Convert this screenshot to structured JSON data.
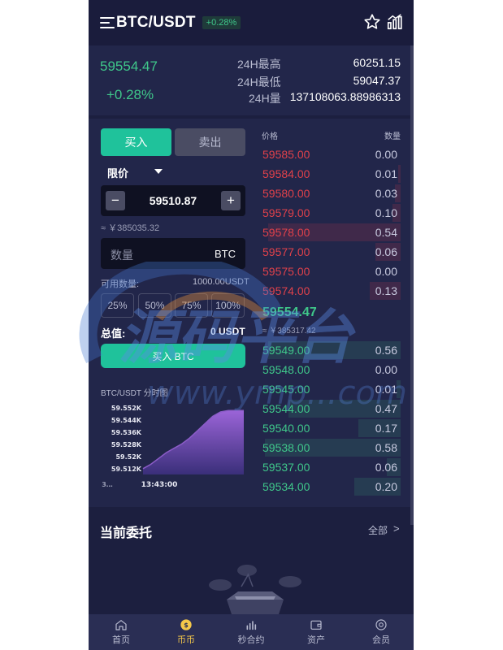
{
  "header": {
    "title": "BTC/USDT",
    "change_badge": "+0.28%"
  },
  "stats": {
    "last_price": "59554.47",
    "change": "+0.28%",
    "high_label": "24H最高",
    "high_value": "60251.15",
    "low_label": "24H最低",
    "low_value": "59047.37",
    "vol_label": "24H量",
    "vol_value": "137108063.88986313"
  },
  "trade": {
    "buy_tab": "买入",
    "sell_tab": "卖出",
    "order_type": "限价",
    "minus": "−",
    "plus": "+",
    "price_value": "59510.87",
    "price_cny": "≈ ￥385035.32",
    "qty_placeholder": "数量",
    "qty_unit": "BTC",
    "avail_label": "可用数量:",
    "avail_value": "1000.00USDT",
    "pct_buttons": [
      "25%",
      "50%",
      "75%",
      "100%"
    ],
    "total_label": "总值:",
    "total_value": "0 USDT",
    "buy_button": "买入 BTC",
    "mini_chart_title": "BTC/USDT 分时图"
  },
  "chart_data": {
    "type": "area",
    "title": "BTC/USDT 分时图",
    "y_ticks": [
      "59.552K",
      "59.544K",
      "59.536K",
      "59.528K",
      "59.52K",
      "59.512K"
    ],
    "x_ticks": [
      "3…",
      "13:43:00"
    ],
    "series": [
      {
        "y": [
          59.512,
          59.515,
          59.519,
          59.523,
          59.526,
          59.529,
          59.533,
          59.538,
          59.543,
          59.548,
          59.551,
          59.552,
          59.552,
          59.552
        ]
      }
    ],
    "ylim": [
      59.508,
      59.556
    ],
    "color": "#8b5cc7"
  },
  "orderbook": {
    "price_header": "价格",
    "qty_header": "数量",
    "asks": [
      {
        "price": "59585.00",
        "qty": "0.00",
        "depth": 0.0
      },
      {
        "price": "59584.00",
        "qty": "0.01",
        "depth": 0.02
      },
      {
        "price": "59580.00",
        "qty": "0.03",
        "depth": 0.04
      },
      {
        "price": "59579.00",
        "qty": "0.10",
        "depth": 0.06
      },
      {
        "price": "59578.00",
        "qty": "0.54",
        "depth": 0.95
      },
      {
        "price": "59577.00",
        "qty": "0.06",
        "depth": 0.18
      },
      {
        "price": "59575.00",
        "qty": "0.00",
        "depth": 0.0
      },
      {
        "price": "59574.00",
        "qty": "0.13",
        "depth": 0.22
      }
    ],
    "mid_price": "59554.47",
    "mid_cny": "≈ ￥385317.42",
    "bids": [
      {
        "price": "59549.00",
        "qty": "0.56",
        "depth": 0.95
      },
      {
        "price": "59548.00",
        "qty": "0.00",
        "depth": 0.0
      },
      {
        "price": "59545.00",
        "qty": "0.01",
        "depth": 0.03
      },
      {
        "price": "59544.00",
        "qty": "0.47",
        "depth": 0.8
      },
      {
        "price": "59540.00",
        "qty": "0.17",
        "depth": 0.3
      },
      {
        "price": "59538.00",
        "qty": "0.58",
        "depth": 0.97
      },
      {
        "price": "59537.00",
        "qty": "0.06",
        "depth": 0.1
      },
      {
        "price": "59534.00",
        "qty": "0.20",
        "depth": 0.33
      }
    ]
  },
  "orders": {
    "title": "当前委托",
    "all_link": "全部",
    "arrow": ">"
  },
  "nav": [
    {
      "label": "首页",
      "icon": "home-icon"
    },
    {
      "label": "币币",
      "icon": "coin-icon",
      "active": true
    },
    {
      "label": "秒合约",
      "icon": "bars-icon"
    },
    {
      "label": "资产",
      "icon": "wallet-icon"
    },
    {
      "label": "会员",
      "icon": "member-icon"
    }
  ],
  "colors": {
    "up": "#3fc78a",
    "down": "#e0414a",
    "accent": "#1fc29b",
    "nav_active": "#f4c84a"
  },
  "watermark": {
    "text": "源码平台",
    "url_text": "www.ymp...com"
  }
}
